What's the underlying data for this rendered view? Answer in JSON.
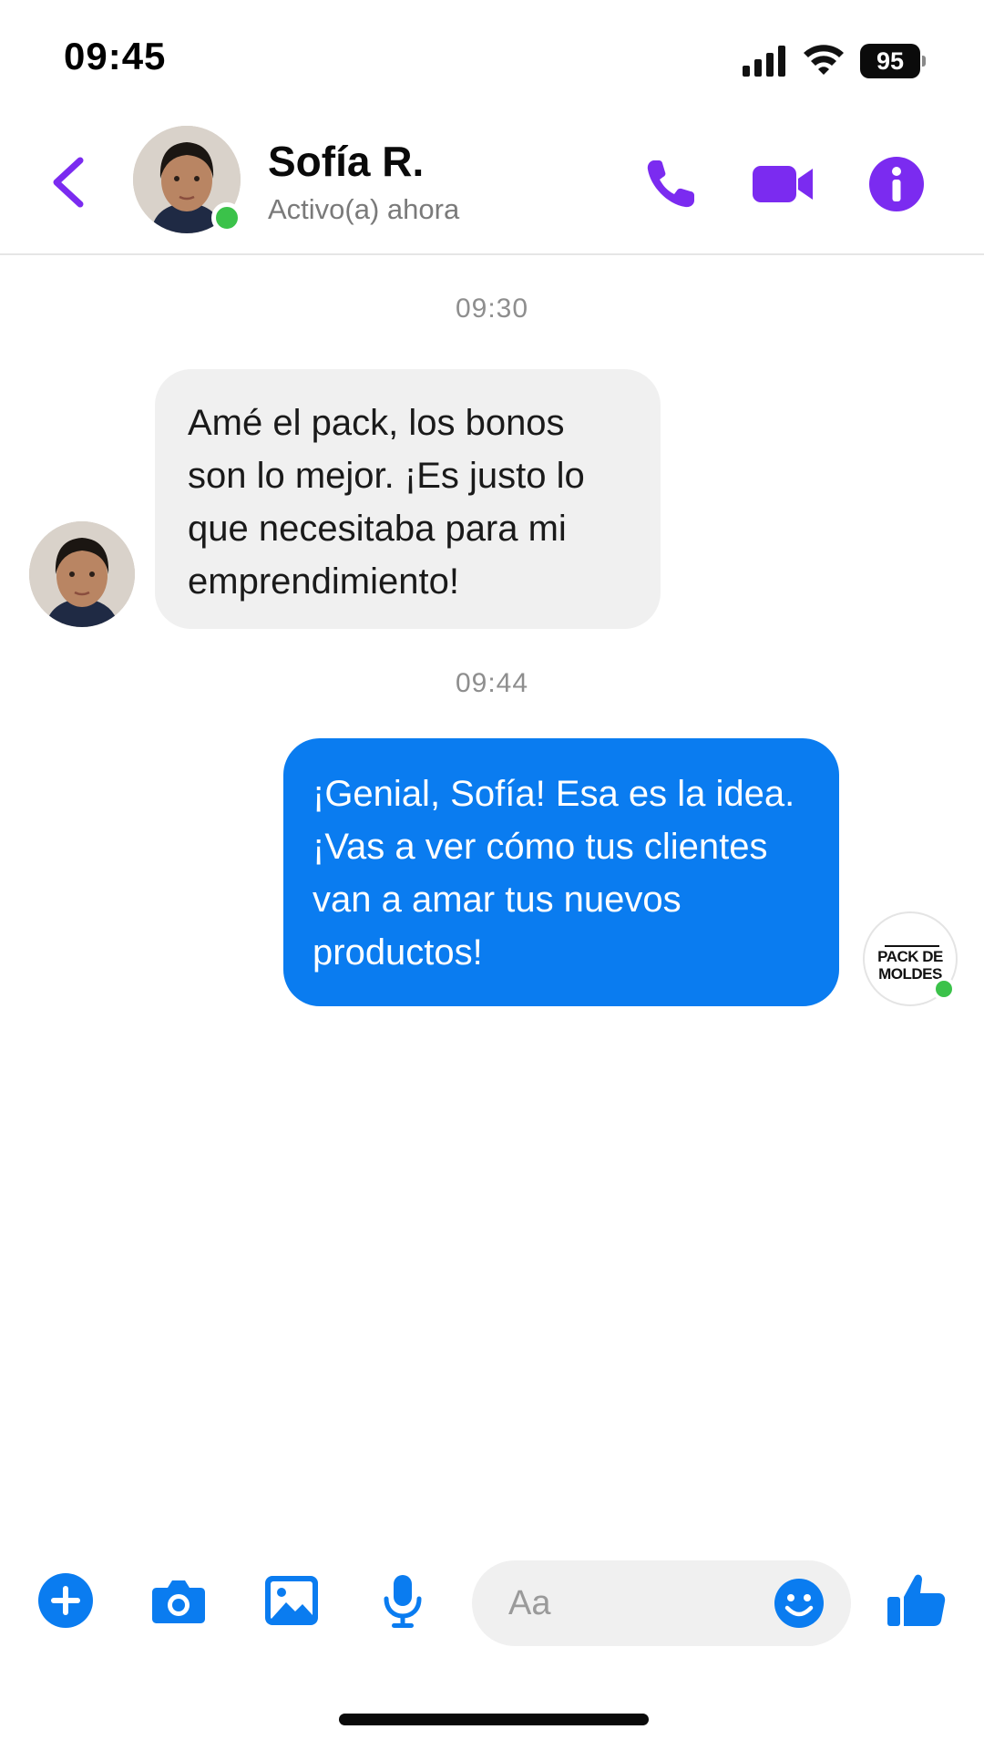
{
  "status_bar": {
    "time": "09:45",
    "battery": "95"
  },
  "header": {
    "contact_name": "Sofía R.",
    "contact_status": "Activo(a) ahora"
  },
  "chat": {
    "timestamp_1": "09:30",
    "incoming_message": "Amé el pack, los bonos son lo mejor. ¡Es justo lo que necesitaba para mi emprendimiento!",
    "timestamp_2": "09:44",
    "outgoing_message": "¡Genial, Sofía! Esa es la idea. ¡Vas a ver cómo tus clientes van a amar tus nuevos productos!",
    "sender_logo_text": "PACK DE MOLDES"
  },
  "composer": {
    "placeholder": "Aa"
  },
  "colors": {
    "accent_purple": "#7b2bf0",
    "accent_blue": "#0a7cf0",
    "incoming_bubble": "#f0f0f0",
    "online_green": "#3bc24a"
  },
  "icons": {
    "header": [
      "back-chevron-icon",
      "phone-icon",
      "video-camera-icon",
      "info-icon"
    ],
    "composer": [
      "plus-icon",
      "camera-icon",
      "gallery-icon",
      "microphone-icon",
      "emoji-icon",
      "thumbs-up-icon"
    ]
  }
}
